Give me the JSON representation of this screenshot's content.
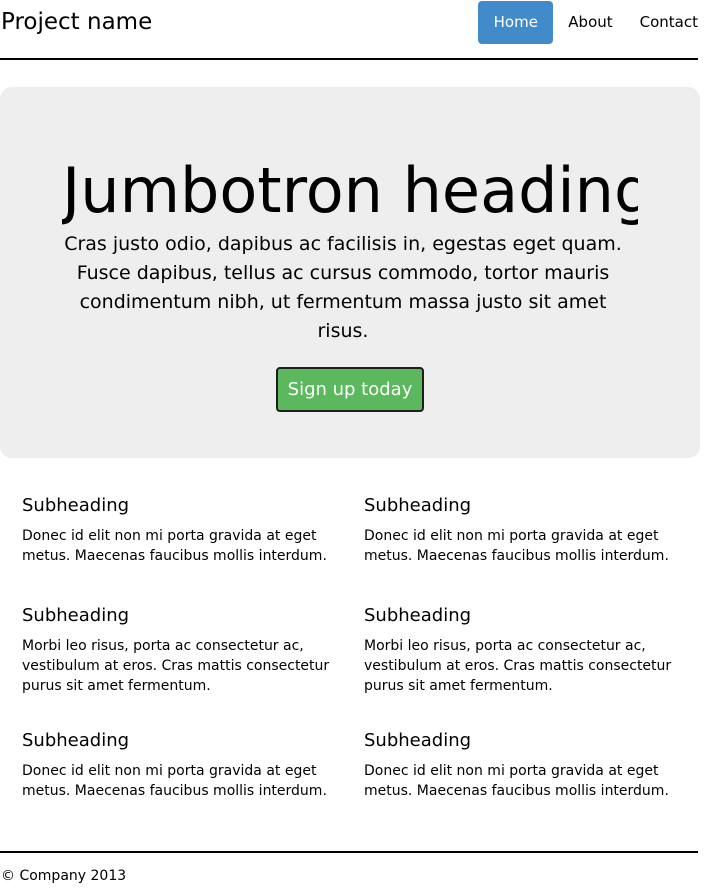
{
  "header": {
    "brand": "Project name",
    "nav": [
      {
        "label": "Home",
        "active": true
      },
      {
        "label": "About",
        "active": false
      },
      {
        "label": "Contact",
        "active": false
      }
    ]
  },
  "jumbotron": {
    "heading": "Jumbotron heading",
    "text": "Cras justo odio, dapibus ac facilisis in, egestas eget quam. Fusce dapibus, tellus ac cursus commodo, tortor mauris condimentum nibh, ut fermentum massa justo sit amet risus.",
    "button_label": "Sign up today"
  },
  "marketing": [
    {
      "heading": "Subheading",
      "text": "Donec id elit non mi porta gravida at eget metus. Maecenas faucibus mollis interdum."
    },
    {
      "heading": "Subheading",
      "text": "Donec id elit non mi porta gravida at eget metus. Maecenas faucibus mollis interdum."
    },
    {
      "heading": "Subheading",
      "text": "Morbi leo risus, porta ac consectetur ac, vestibulum at eros. Cras mattis consectetur purus sit amet fermentum."
    },
    {
      "heading": "Subheading",
      "text": "Morbi leo risus, porta ac consectetur ac, vestibulum at eros. Cras mattis consectetur purus sit amet fermentum."
    },
    {
      "heading": "Subheading",
      "text": "Donec id elit non mi porta gravida at eget metus. Maecenas faucibus mollis interdum."
    },
    {
      "heading": "Subheading",
      "text": "Donec id elit non mi porta gravida at eget metus. Maecenas faucibus mollis interdum."
    }
  ],
  "footer": {
    "text": "© Company 2013"
  },
  "colors": {
    "nav_active_bg": "#428bca",
    "button_bg": "#5cb85c",
    "jumbotron_bg": "#eeeeee"
  }
}
